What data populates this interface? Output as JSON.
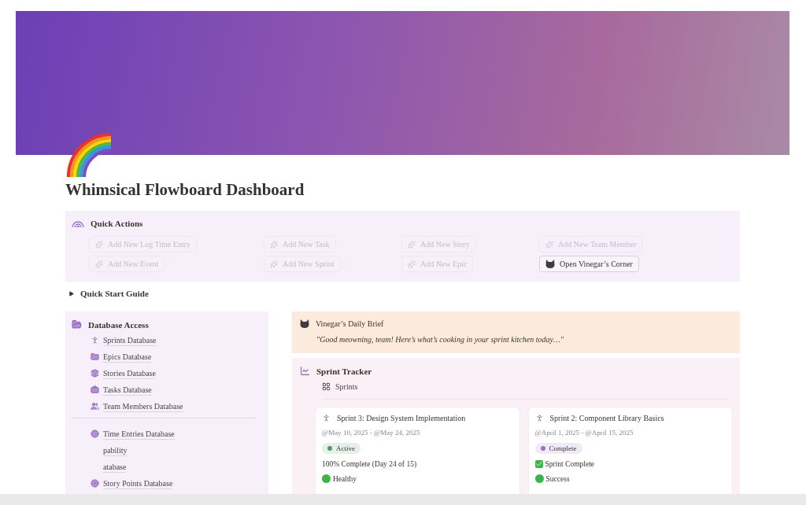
{
  "page": {
    "title": "Whimsical Flowboard Dashboard"
  },
  "quick_actions": {
    "title": "Quick Actions",
    "buttons": [
      {
        "label": "Add New Log Time Entry",
        "disabled": true
      },
      {
        "label": "Add New Task",
        "disabled": true
      },
      {
        "label": "Add New Story",
        "disabled": true
      },
      {
        "label": "Add New Team Member",
        "disabled": true
      },
      {
        "label": "Add New Event",
        "disabled": true
      },
      {
        "label": "Add New Sprint",
        "disabled": true
      },
      {
        "label": "Add New Epic",
        "disabled": true
      },
      {
        "label": "Open Vinegar’s Corner",
        "disabled": false
      }
    ]
  },
  "quick_start": {
    "label": "Quick Start Guide",
    "expanded": false
  },
  "database_access": {
    "title": "Database Access",
    "groups": [
      [
        "Sprints Database",
        "Epics Database",
        "Stories Database",
        "Tasks Database",
        "Team Members Database"
      ],
      [
        "Time Entries Database",
        "pability",
        "atabase",
        "Story Points Database"
      ]
    ]
  },
  "daily_brief": {
    "title": "Vinegar’s Daily Brief",
    "quote": "\"Good meowning, team! Here’s what’s cooking in your sprint kitchen today…\""
  },
  "sprint_tracker": {
    "title": "Sprint Tracker",
    "view": "Sprints",
    "cards": [
      {
        "title": "Sprint 3: Design System Implementation",
        "dates": "@May 10, 2025 - @May 24, 2025",
        "status": "Active",
        "color": "#4f9a6a",
        "progress": "100% Complete (Day 24 of 15)",
        "complete": false,
        "health": "Healthy"
      },
      {
        "title": "Sprint 2: Component Library Basics",
        "dates": "@April 1, 2025 - @April 15, 2025",
        "status": "Complete",
        "color": "#9a6fc4",
        "progress": "Sprint Complete",
        "complete": true,
        "health": "Success"
      }
    ]
  }
}
